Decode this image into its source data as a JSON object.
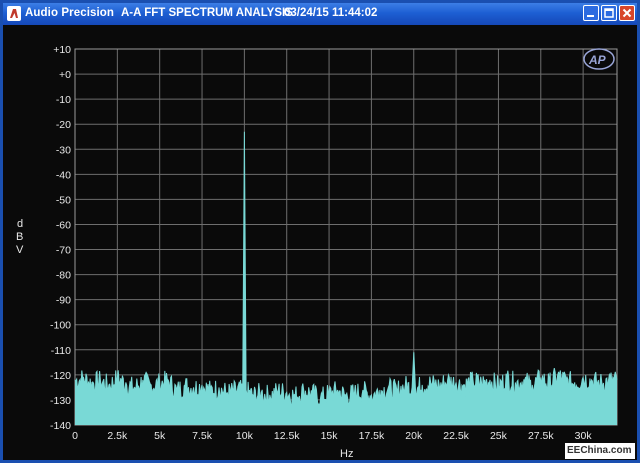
{
  "window": {
    "app_name": "Audio Precision",
    "document_title": "A-A FFT SPECTRUM ANALYSIS",
    "timestamp": "03/24/15 11:44:02",
    "minimize_icon": "minimize-icon",
    "maximize_icon": "maximize-icon",
    "close_icon": "close-icon"
  },
  "logo": {
    "text": "AP"
  },
  "watermark": {
    "text": "EEChina.com"
  },
  "colors": {
    "trace": "#79d9d6",
    "grid": "#6e6e6e",
    "background": "#0a0a0a"
  },
  "chart_data": {
    "type": "line",
    "title": "",
    "xlabel": "Hz",
    "ylabel": "dBV",
    "xlim": [
      0,
      32000
    ],
    "ylim": [
      -140,
      10
    ],
    "grid": true,
    "x_ticks": [
      0,
      2500,
      5000,
      7500,
      10000,
      12500,
      15000,
      17500,
      20000,
      22500,
      25000,
      27500,
      30000
    ],
    "x_tick_labels": [
      "0",
      "2.5k",
      "5k",
      "7.5k",
      "10k",
      "12.5k",
      "15k",
      "17.5k",
      "20k",
      "22.5k",
      "25k",
      "27.5k",
      "30k"
    ],
    "y_ticks": [
      10,
      0,
      -10,
      -20,
      -30,
      -40,
      -50,
      -60,
      -70,
      -80,
      -90,
      -100,
      -110,
      -120,
      -130,
      -140
    ],
    "y_tick_labels": [
      "+10",
      "+0",
      "-10",
      "-20",
      "-30",
      "-40",
      "-50",
      "-60",
      "-70",
      "-80",
      "-90",
      "-100",
      "-110",
      "-120",
      "-130",
      "-140"
    ],
    "series": [
      {
        "x": [
          0,
          500,
          1000,
          1500,
          2000,
          2500,
          3000,
          3500,
          4000,
          4500,
          5000,
          5500,
          6000,
          6500,
          7000,
          7500,
          8000,
          8500,
          9000,
          9500,
          9900,
          10000,
          10100,
          10500,
          11000,
          11500,
          12000,
          12500,
          13000,
          13500,
          14000,
          14500,
          15000,
          15500,
          16000,
          16500,
          17000,
          17500,
          18000,
          18500,
          19000,
          19500,
          19900,
          20000,
          20100,
          20500,
          21000,
          21500,
          22000,
          22500,
          23000,
          23500,
          24000,
          24500,
          25000,
          25500,
          26000,
          26500,
          27000,
          27500,
          28000,
          28500,
          29000,
          29500,
          30000,
          30500,
          31000,
          31500,
          32000
        ],
        "y": [
          -122,
          -121,
          -123,
          -122,
          -124,
          -121,
          -123,
          -125,
          -122,
          -124,
          -123,
          -122,
          -126,
          -124,
          -125,
          -124,
          -126,
          -125,
          -127,
          -126,
          -126,
          -23,
          -126,
          -128,
          -127,
          -128,
          -126,
          -127,
          -128,
          -126,
          -127,
          -129,
          -127,
          -126,
          -128,
          -127,
          -126,
          -128,
          -126,
          -125,
          -126,
          -124,
          -125,
          -111,
          -125,
          -124,
          -123,
          -124,
          -122,
          -123,
          -124,
          -122,
          -123,
          -122,
          -124,
          -121,
          -123,
          -122,
          -124,
          -121,
          -123,
          -120,
          -122,
          -123,
          -121,
          -122,
          -123,
          -122,
          -122
        ]
      }
    ]
  }
}
